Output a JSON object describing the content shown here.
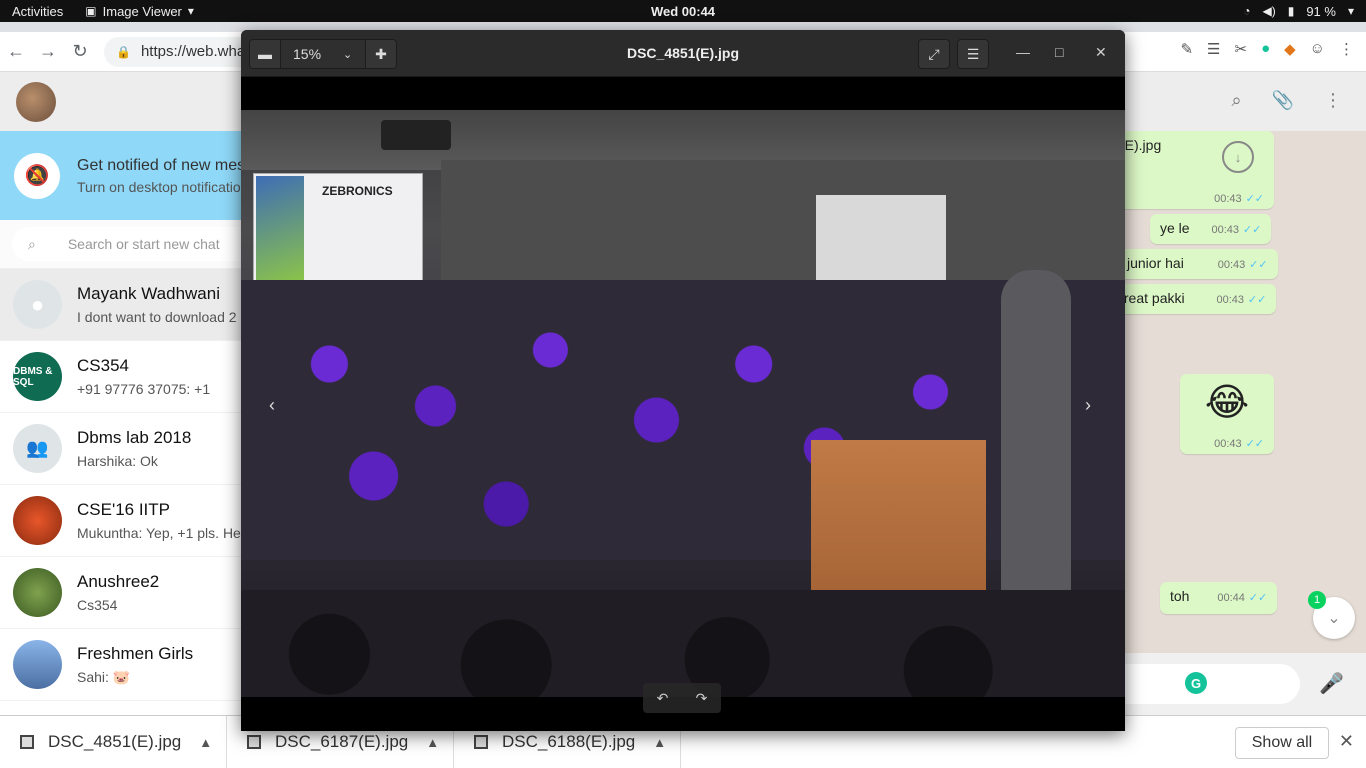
{
  "topbar": {
    "activities": "Activities",
    "app_name": "Image Viewer",
    "clock": "Wed 00:44",
    "battery": "91 %"
  },
  "browser": {
    "url": "https://web.wha"
  },
  "whatsapp": {
    "notify_title": "Get notified of new mes",
    "notify_sub": "Turn on desktop notificatio",
    "search_placeholder": "Search or start new chat",
    "chats": [
      {
        "name": "Mayank Wadhwani",
        "last": "I dont want to download 2"
      },
      {
        "name": "CS354",
        "last": "+91 97776 37075: +1",
        "avatar_text": "DBMS & SQL"
      },
      {
        "name": "Dbms lab 2018",
        "last": "Harshika: Ok"
      },
      {
        "name": "CSE'16 IITP",
        "last": "Mukuntha: Yep, +1 pls. He"
      },
      {
        "name": "Anushree2",
        "last": "Cs354"
      },
      {
        "name": "Freshmen Girls",
        "last": "Sahi: 🐷"
      }
    ],
    "messages": [
      {
        "text": "(E).jpg",
        "time": "00:43"
      },
      {
        "text": "ye le",
        "time": "00:43"
      },
      {
        "text": "i junior hai",
        "time": "00:43"
      },
      {
        "text": "treat pakki",
        "time": "00:43"
      },
      {
        "text": "😂",
        "time": "00:43"
      },
      {
        "text": "toh",
        "time": "00:44"
      }
    ],
    "unread_count": "1",
    "composer_g": "G"
  },
  "viewer": {
    "title": "DSC_4851(E).jpg",
    "zoom": "15%"
  },
  "photo": {
    "poster_logo": "ZEBRONICS"
  },
  "downloads": {
    "items": [
      "DSC_4851(E).jpg",
      "DSC_6187(E).jpg",
      "DSC_6188(E).jpg"
    ],
    "show_all": "Show all"
  },
  "colors": {
    "wa_notify": "#8fd8f7",
    "wa_bubble": "#dcf8c6",
    "tick": "#4fc3f7",
    "grammarly": "#15c39a",
    "shirt_purple": "#6a2bd4"
  }
}
